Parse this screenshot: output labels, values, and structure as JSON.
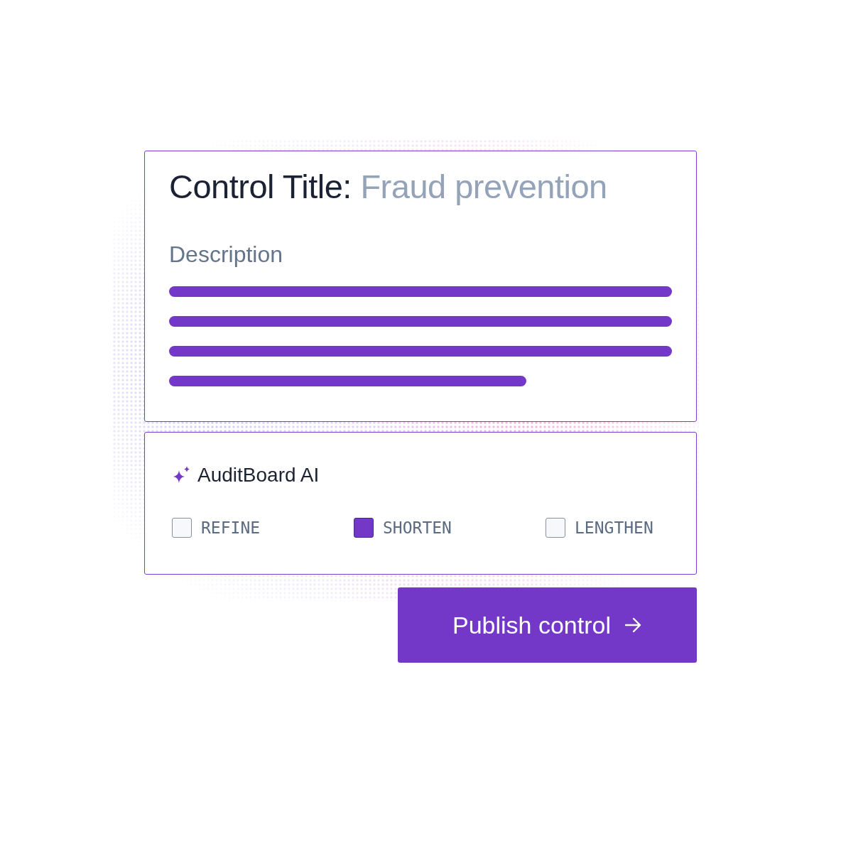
{
  "control_card": {
    "title_label": "Control Title:",
    "title_value": "Fraud prevention",
    "description_label": "Description"
  },
  "ai_panel": {
    "title": "AuditBoard AI",
    "options": [
      {
        "label": "REFINE",
        "checked": false
      },
      {
        "label": "SHORTEN",
        "checked": true
      },
      {
        "label": "LENGTHEN",
        "checked": false
      }
    ]
  },
  "publish_button": {
    "label": "Publish control"
  }
}
